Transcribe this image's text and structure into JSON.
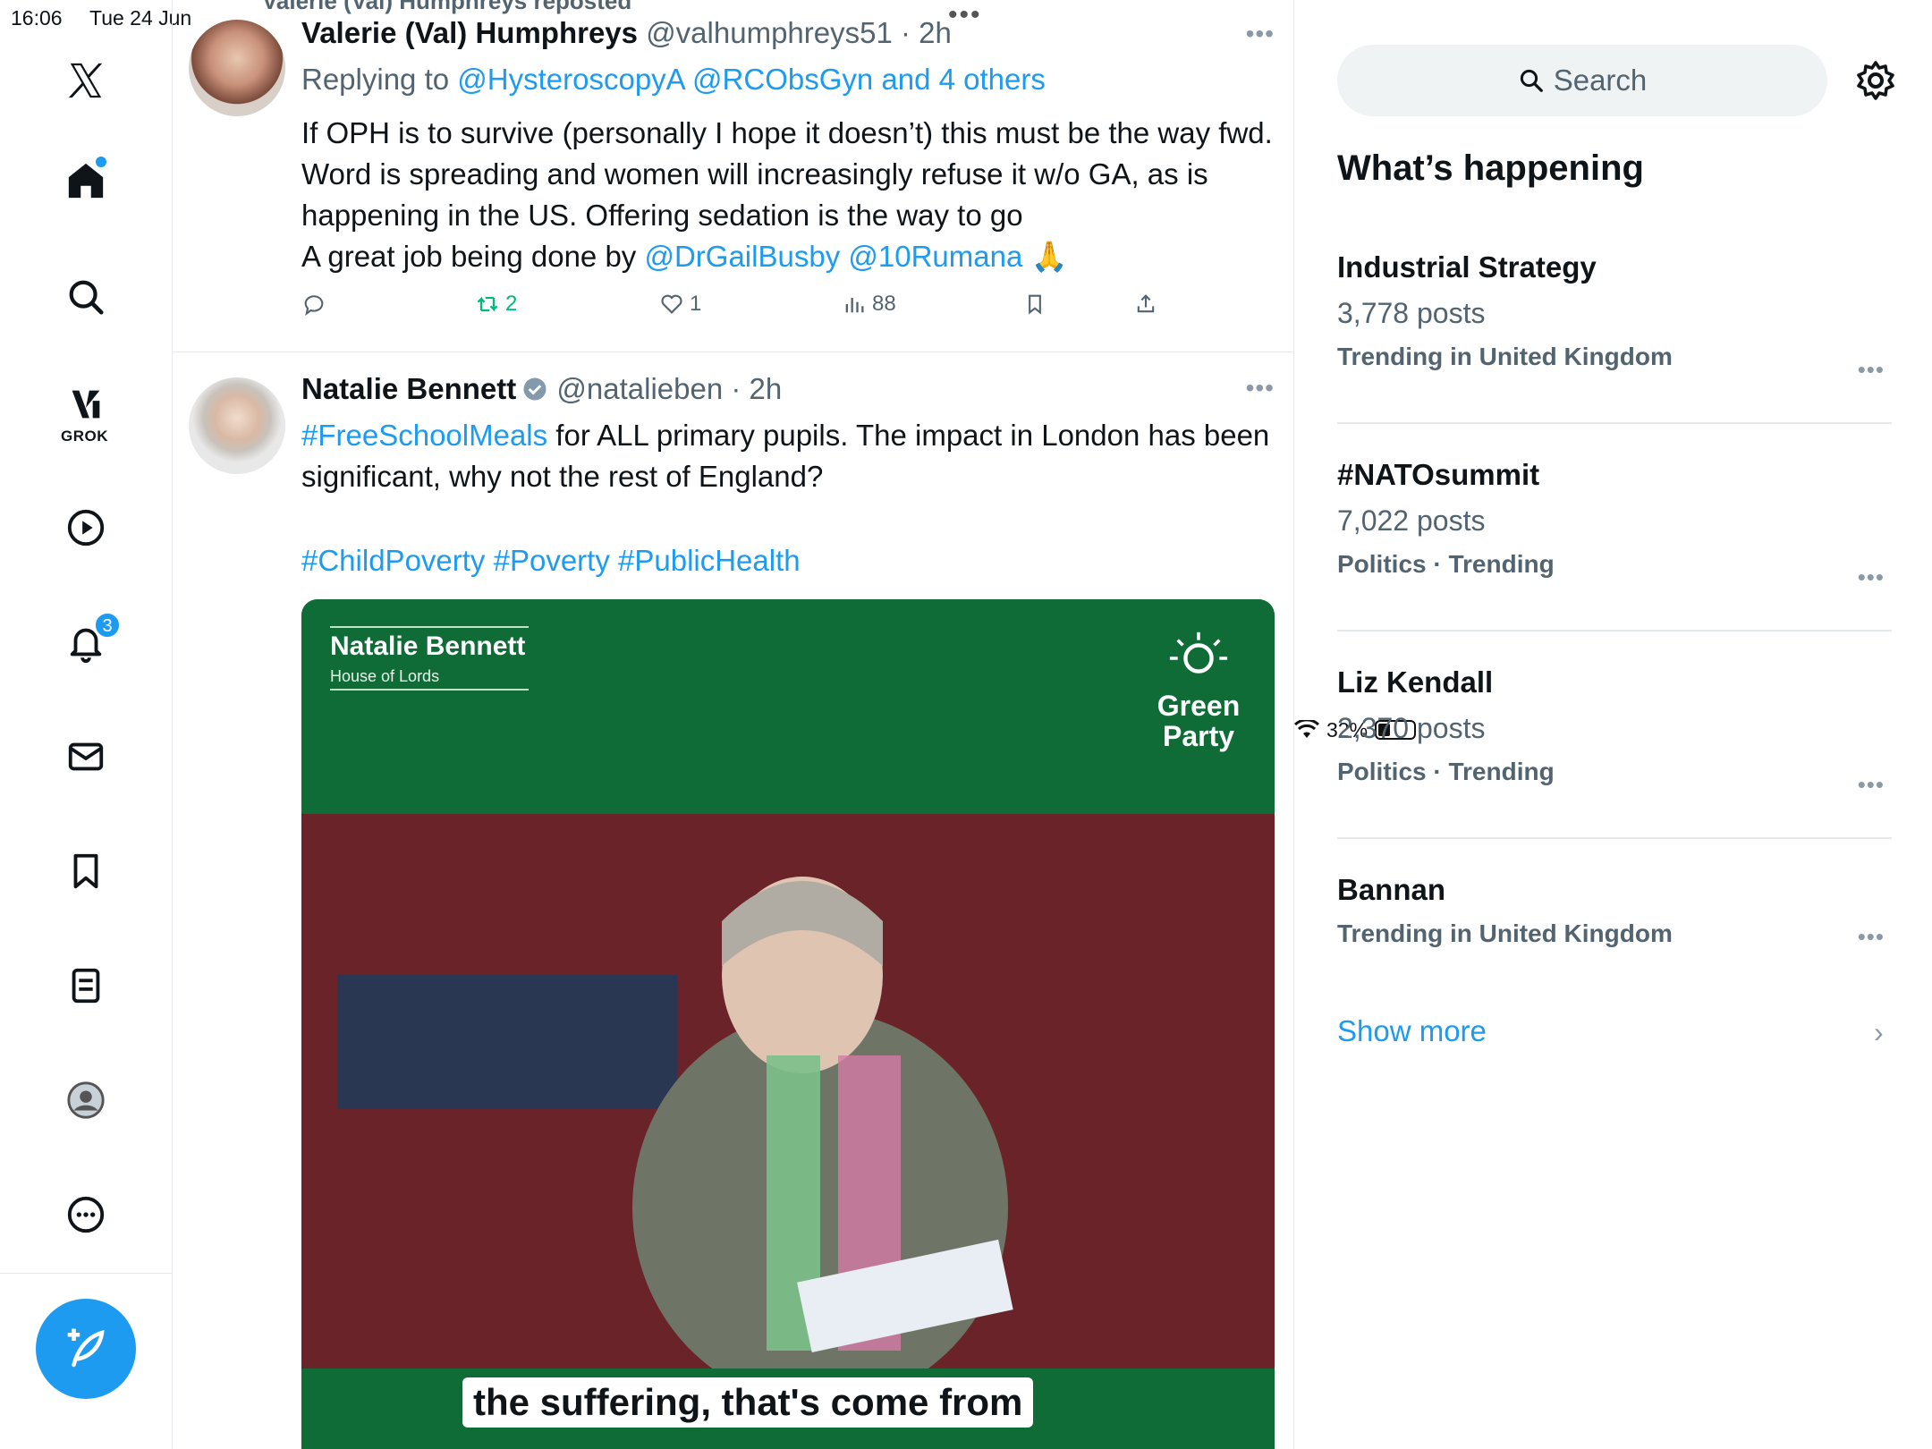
{
  "status": {
    "time": "16:06",
    "date": "Tue 24 Jun",
    "battery": "32%"
  },
  "nav": {
    "notifications_badge": "3",
    "grok_label": "GROK"
  },
  "feed": {
    "repost_banner": "Valerie (Val) Humphreys reposted",
    "tweet1": {
      "name": "Valerie (Val) Humphreys",
      "handle": "@valhumphreys51",
      "time": "2h",
      "replying_prefix": "Replying to ",
      "replying_to": "@HysteroscopyA @RCObsGyn and 4 others",
      "text": "If OPH is to survive (personally I hope it doesn’t) this must be the way fwd. Word is spreading and women will increasingly refuse it w/o GA, as is happening in the US. Offering sedation is the way to go",
      "text2_prefix": "A great job being done by ",
      "mentions": "@DrGailBusby @10Rumana",
      "emoji": "🙏",
      "retweets": "2",
      "likes": "1",
      "views": "88"
    },
    "tweet2": {
      "name": "Natalie Bennett",
      "handle": "@natalieben",
      "time": "2h",
      "hashtag1": "#FreeSchoolMeals",
      "text": " for ALL primary pupils. The impact in London has been significant, why not the rest of England?",
      "hashtags": "#ChildPoverty #Poverty #PublicHealth",
      "media": {
        "banner_name": "Natalie Bennett",
        "banner_sub": "House of Lords",
        "party_line1": "Green",
        "party_line2": "Party",
        "caption": "the suffering, that's come from"
      }
    }
  },
  "sidebar": {
    "search_placeholder": "Search",
    "section_title": "What’s happening",
    "trends": [
      {
        "name": "Industrial Strategy",
        "posts": "3,778 posts",
        "context": "Trending in United Kingdom"
      },
      {
        "name": "#NATOsummit",
        "posts": "7,022 posts",
        "context": "Politics · Trending"
      },
      {
        "name": "Liz Kendall",
        "posts": "2,370 posts",
        "context": "Politics · Trending"
      },
      {
        "name": "Bannan",
        "posts": "",
        "context": "Trending in United Kingdom"
      }
    ],
    "show_more": "Show more"
  },
  "colors": {
    "accent": "#1d9bf0",
    "retweet_green": "#00ba7c",
    "party_green": "#0f6c37"
  }
}
